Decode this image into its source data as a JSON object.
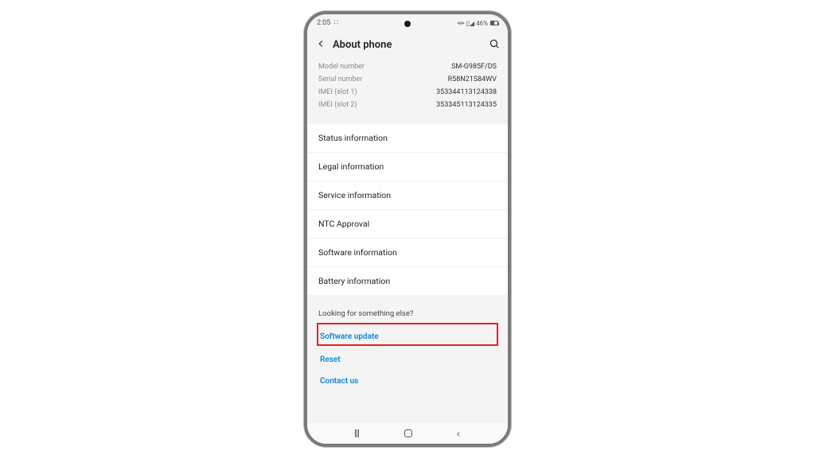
{
  "status": {
    "time": "2:05",
    "battery_pct": "46%"
  },
  "header": {
    "title": "About phone"
  },
  "info": [
    {
      "label": "Model number",
      "value": "SM-G985F/DS"
    },
    {
      "label": "Serial number",
      "value": "R58N21S84WV"
    },
    {
      "label": "IMEI (slot 1)",
      "value": "353344113124338"
    },
    {
      "label": "IMEI (slot 2)",
      "value": "353345113124335"
    }
  ],
  "menu": [
    "Status information",
    "Legal information",
    "Service information",
    "NTC Approval",
    "Software information",
    "Battery information"
  ],
  "footer": {
    "title": "Looking for something else?",
    "links": [
      "Software update",
      "Reset",
      "Contact us"
    ],
    "highlighted_index": 0
  }
}
